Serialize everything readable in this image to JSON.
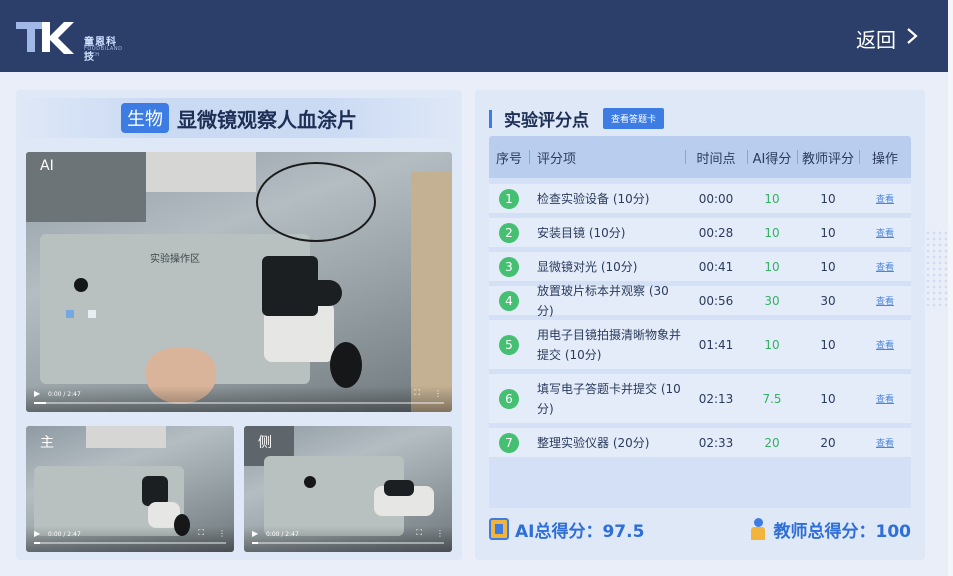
{
  "header": {
    "logo_text": "童恩科技",
    "logo_sub": "FOODBILAND TECH",
    "back_label": "返回"
  },
  "lesson": {
    "subject": "生物",
    "title": "显微镜观察人血涂片"
  },
  "videos": {
    "main": {
      "tag": "AI",
      "time": "0:00 / 2:47",
      "desk_label": "实验操作区"
    },
    "front": {
      "tag": "主",
      "time": "0:00 / 2:47"
    },
    "side": {
      "tag": "侧",
      "time": "0:00 / 2:47"
    }
  },
  "scoring": {
    "title": "实验评分点",
    "answer_button": "查看答题卡",
    "columns": [
      "序号",
      "评分项",
      "时间点",
      "AI得分",
      "教师评分",
      "操作"
    ],
    "rows": [
      {
        "no": "1",
        "item": "检查实验设备 (10分)",
        "time": "00:00",
        "ai": "10",
        "teacher": "10",
        "op": "查看"
      },
      {
        "no": "2",
        "item": "安装目镜 (10分)",
        "time": "00:28",
        "ai": "10",
        "teacher": "10",
        "op": "查看"
      },
      {
        "no": "3",
        "item": "显微镜对光 (10分)",
        "time": "00:41",
        "ai": "10",
        "teacher": "10",
        "op": "查看"
      },
      {
        "no": "4",
        "item": "放置玻片标本并观察 (30分)",
        "time": "00:56",
        "ai": "30",
        "teacher": "30",
        "op": "查看"
      },
      {
        "no": "5",
        "item": "用电子目镜拍摄清晰物象并提交 (10分)",
        "time": "01:41",
        "ai": "10",
        "teacher": "10",
        "op": "查看"
      },
      {
        "no": "6",
        "item": "填写电子答题卡并提交 (10分)",
        "time": "02:13",
        "ai": "7.5",
        "teacher": "10",
        "op": "查看"
      },
      {
        "no": "7",
        "item": "整理实验仪器 (20分)",
        "time": "02:33",
        "ai": "20",
        "teacher": "20",
        "op": "查看"
      }
    ],
    "ai_total_label": "AI总得分：97.5",
    "teacher_total_label": "教师总得分：100"
  },
  "colors": {
    "header_bg": "#2c3f6b",
    "accent": "#3d7de3",
    "ai_score": "#35b066"
  },
  "icons": [
    "chevron-right-icon",
    "ai-score-icon",
    "teacher-score-icon",
    "play-icon",
    "fullscreen-icon",
    "more-icon"
  ]
}
